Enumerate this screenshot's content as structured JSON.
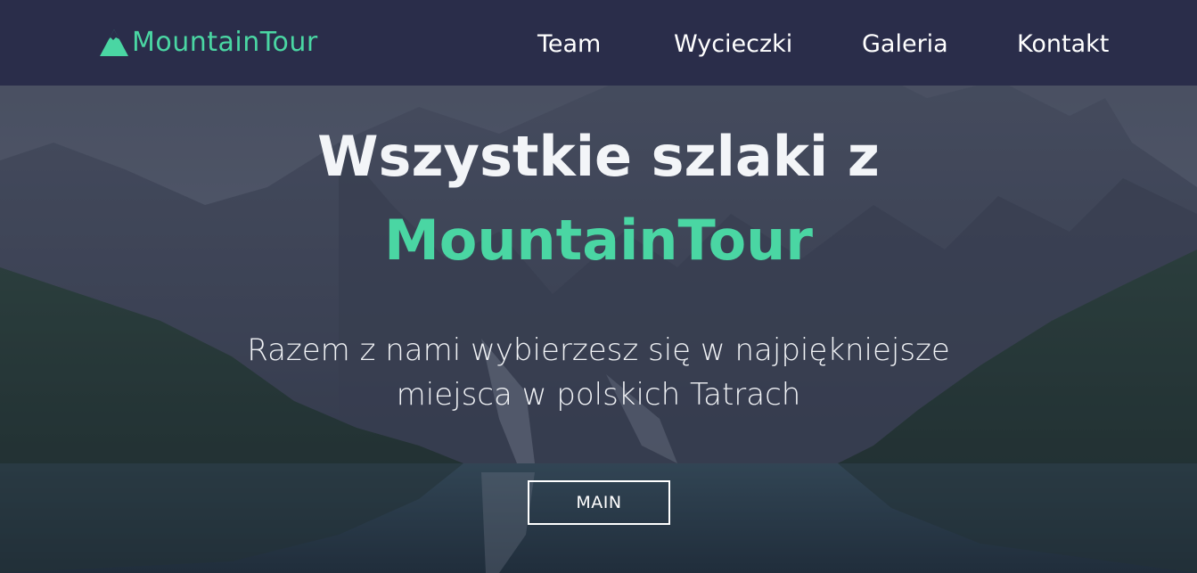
{
  "brand": {
    "name": "MountainTour",
    "icon": "mountain-icon",
    "accent_color": "#4ad6a3"
  },
  "nav": {
    "items": [
      {
        "label": "Team"
      },
      {
        "label": "Wycieczki"
      },
      {
        "label": "Galeria"
      },
      {
        "label": "Kontakt"
      }
    ],
    "background": "#2a2d4a"
  },
  "hero": {
    "headline_line1": "Wszystkie szlaki z",
    "headline_line2": "MountainTour",
    "lead_line1": "Razem z nami wybierzesz się w najpiękniejsze",
    "lead_line2": "miejsca w polskich Tatrach",
    "button_label": "MAIN",
    "background_image": "mountain-lake-landscape"
  }
}
